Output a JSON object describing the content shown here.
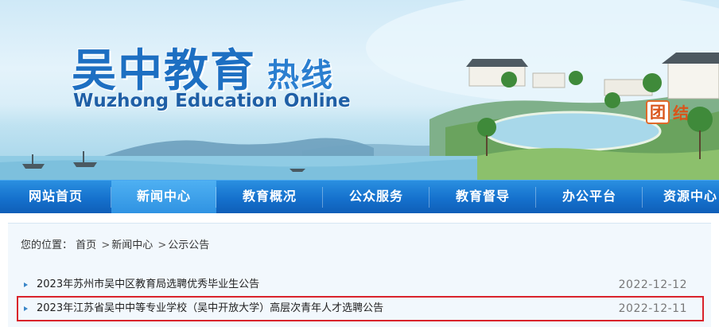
{
  "header": {
    "logo_cn_main": "吴中教育",
    "logo_cn_sub": "热线",
    "logo_en": "Wuzhong Education Online",
    "badge_chars": [
      "团",
      "结"
    ]
  },
  "nav": {
    "items": [
      {
        "label": "网站首页",
        "active": false
      },
      {
        "label": "新闻中心",
        "active": true
      },
      {
        "label": "教育概况",
        "active": false
      },
      {
        "label": "公众服务",
        "active": false
      },
      {
        "label": "教育督导",
        "active": false
      },
      {
        "label": "办公平台",
        "active": false
      },
      {
        "label": "资源中心",
        "active": false
      }
    ]
  },
  "breadcrumb": {
    "prefix": "您的位置：",
    "items": [
      "首页",
      "新闻中心",
      "公示公告"
    ],
    "separator": ">"
  },
  "news": [
    {
      "title": "2023年苏州市吴中区教育局选聘优秀毕业生公告",
      "date": "2022-12-12",
      "highlighted": false
    },
    {
      "title": "2023年江苏省吴中中等专业学校（吴中开放大学）高层次青年人才选聘公告",
      "date": "2022-12-11",
      "highlighted": true
    }
  ],
  "colors": {
    "nav_blue": "#1571cd",
    "logo_blue": "#1d6fc2",
    "highlight_red": "#d9232b"
  }
}
